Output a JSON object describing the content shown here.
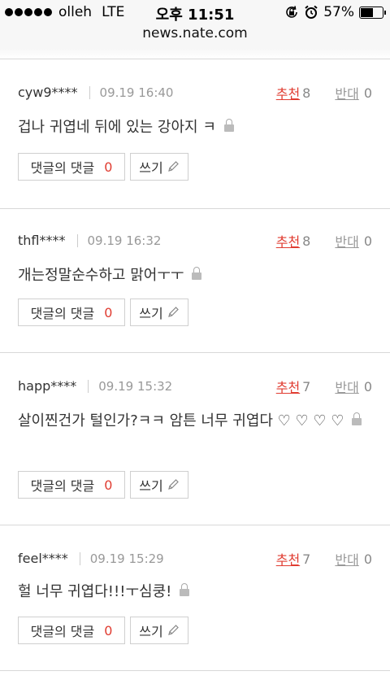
{
  "status": {
    "carrier": "olleh",
    "network": "LTE",
    "time": "오후 11:51",
    "battery": "57%",
    "battery_level": 0.57
  },
  "browser": {
    "url": "news.nate.com"
  },
  "labels": {
    "recommend": "추천",
    "oppose": "반대",
    "reply_button": "댓글의 댓글",
    "write_button": "쓰기"
  },
  "comments": [
    {
      "user": "cyw9****",
      "date": "09.19 16:40",
      "recommend": "8",
      "oppose": "0",
      "text": "겁나 귀엽네 뒤에 있는 강아지 ㅋ",
      "replies": "0"
    },
    {
      "user": "thfl****",
      "date": "09.19 16:32",
      "recommend": "8",
      "oppose": "0",
      "text": "개는정말순수하고 맑어ㅜㅜ",
      "replies": "0"
    },
    {
      "user": "happ****",
      "date": "09.19 15:32",
      "recommend": "7",
      "oppose": "0",
      "text": "살이찐건가 털인가?ㅋㅋ 암튼 너무 귀엽다 ♡ ♡ ♡ ♡",
      "replies": "0"
    },
    {
      "user": "feel****",
      "date": "09.19 15:29",
      "recommend": "7",
      "oppose": "0",
      "text": "헐 너무 귀엽다!!!ㅜ심쿵!",
      "replies": "0"
    }
  ]
}
